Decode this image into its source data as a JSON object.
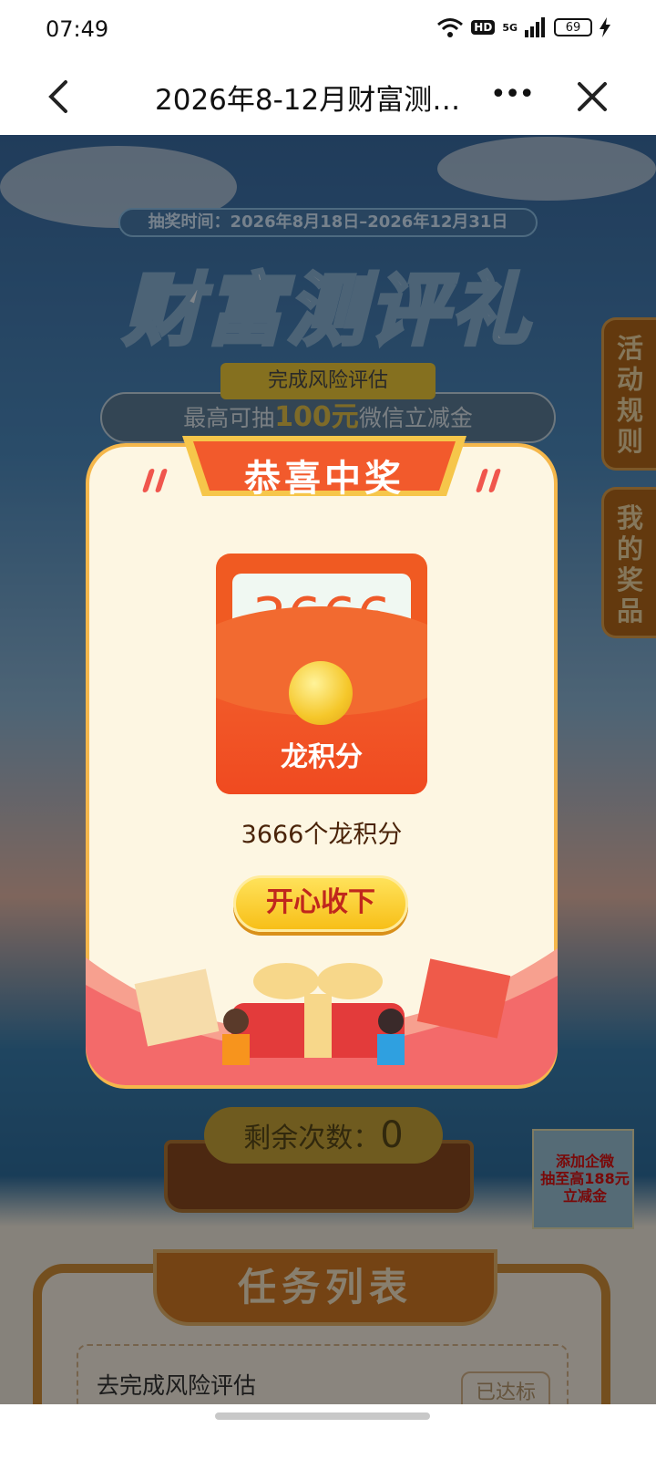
{
  "status_bar": {
    "time": "07:49",
    "battery": "69",
    "hd": "HD",
    "network": "5G"
  },
  "nav": {
    "title": "2026年8-12月财富测…",
    "more": "•••"
  },
  "hero": {
    "lottery_time": "抽奖时间：2026年8月18日–2026年12月31日",
    "title": "财富测评礼",
    "subtitle": "完成风险评估",
    "max_prize_prefix": "最高可抽",
    "max_prize_highlight": "100元",
    "max_prize_suffix": "微信立减金"
  },
  "side_tabs": {
    "rules": "活动规则",
    "my_prizes": "我的奖品"
  },
  "remaining": {
    "label": "剩余次数：",
    "count": "0"
  },
  "ad": {
    "line1": "添加企微",
    "line2": "抽至高188元",
    "line3": "立减金"
  },
  "tasks": {
    "title": "任务列表",
    "items": [
      {
        "label": "去完成风险评估",
        "status": "已达标"
      }
    ]
  },
  "modal": {
    "header": "恭喜中奖",
    "prize_amount": "3666",
    "prize_unit": "龙积分",
    "prize_desc": "3666个龙积分",
    "accept_button": "开心收下"
  },
  "colors": {
    "accent_red": "#f0564d",
    "gold": "#f7bf18",
    "modal_bg": "#fdf6e2"
  }
}
